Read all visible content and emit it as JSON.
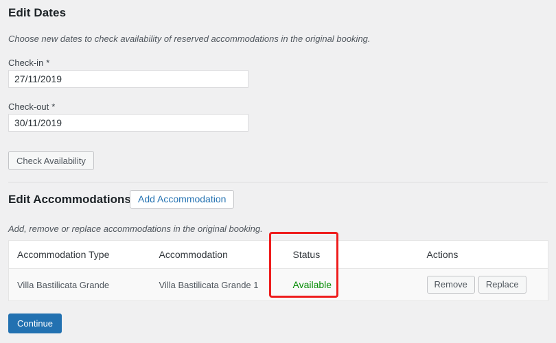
{
  "dates_section": {
    "heading": "Edit Dates",
    "description": "Choose new dates to check availability of reserved accommodations in the original booking.",
    "checkin": {
      "label": "Check-in",
      "required_mark": "*",
      "value": "27/11/2019"
    },
    "checkout": {
      "label": "Check-out",
      "required_mark": "*",
      "value": "30/11/2019"
    },
    "check_availability_label": "Check Availability"
  },
  "accommodations_section": {
    "heading": "Edit Accommodations",
    "add_button_label": "Add Accommodation",
    "description": "Add, remove or replace accommodations in the original booking.",
    "table": {
      "columns": [
        "Accommodation Type",
        "Accommodation",
        "Status",
        "Actions"
      ],
      "rows": [
        {
          "type": "Villa Bastilicata Grande",
          "accommodation": "Villa Bastilicata Grande 1",
          "status": "Available",
          "status_color": "#008a00",
          "actions": {
            "remove_label": "Remove",
            "replace_label": "Replace"
          }
        }
      ]
    }
  },
  "footer": {
    "continue_label": "Continue"
  },
  "annotation": {
    "highlight_color": "#ee1c1c",
    "highlight_target": "Status"
  },
  "theme": {
    "background": "#f0f0f1",
    "link_blue": "#2271b1",
    "primary_button": "#2271b1",
    "available_green": "#008a00",
    "highlight_red": "#ee1c1c"
  }
}
